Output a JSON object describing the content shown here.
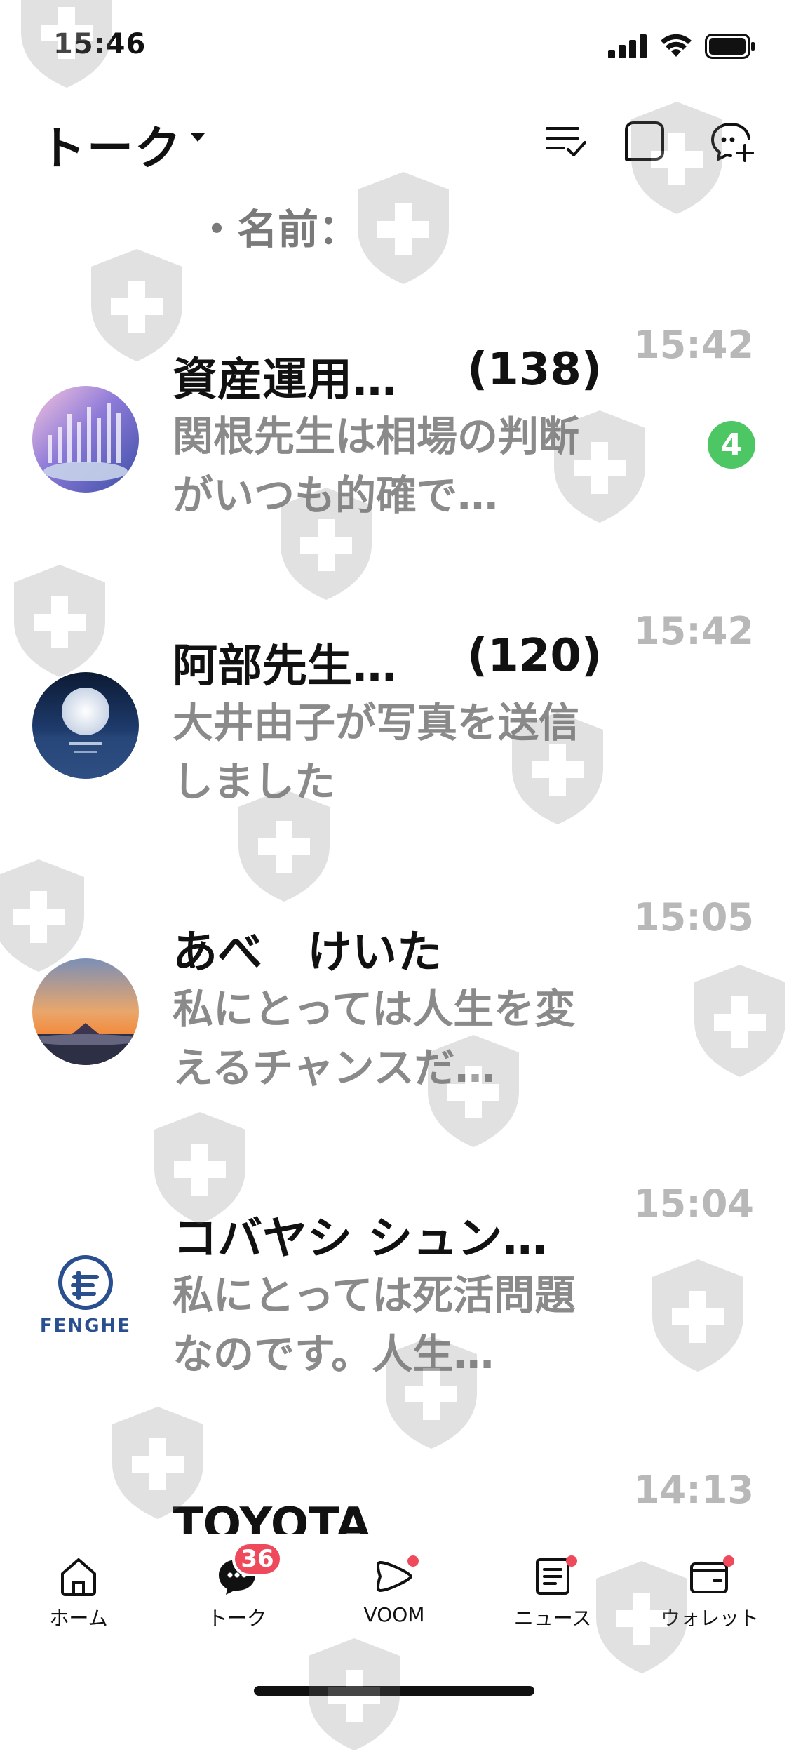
{
  "status_bar": {
    "time": "15:46"
  },
  "header": {
    "title": "トーク"
  },
  "partial_item": {
    "message": "・名前："
  },
  "chats": [
    {
      "name": "資産運用…",
      "count": "(138)",
      "message": "関根先生は相場の判断がいつも的確で…",
      "time": "15:42",
      "unread": "4",
      "avatar": "chart-avatar"
    },
    {
      "name": "阿部先生…",
      "count": "(120)",
      "message": "大井由子が写真を送信しました",
      "time": "15:42",
      "unread": "",
      "avatar": "moon-avatar"
    },
    {
      "name": "あべ　けいた",
      "count": "",
      "message": "私にとっては人生を変えるチャンスだ…",
      "time": "15:05",
      "unread": "",
      "avatar": "mountain-avatar"
    },
    {
      "name": "コバヤシ シュン…",
      "count": "",
      "message": "私にとっては死活問題なのです。人生…",
      "time": "15:04",
      "unread": "",
      "avatar": "fenghe-logo",
      "logo_text": "FENGHE"
    },
    {
      "name": "TOYOTA",
      "count": "",
      "message": "",
      "time": "14:13",
      "unread": "",
      "avatar": ""
    }
  ],
  "bottom_nav": {
    "home": "ホーム",
    "talk": "トーク",
    "talk_badge": "36",
    "voom": "VOOM",
    "news": "ニュース",
    "wallet": "ウォレット"
  },
  "colors": {
    "unread_green": "#4cc764",
    "badge_red": "#ef4a5b",
    "time_gray": "#b8b8b8",
    "message_gray": "#8a8a8a"
  }
}
